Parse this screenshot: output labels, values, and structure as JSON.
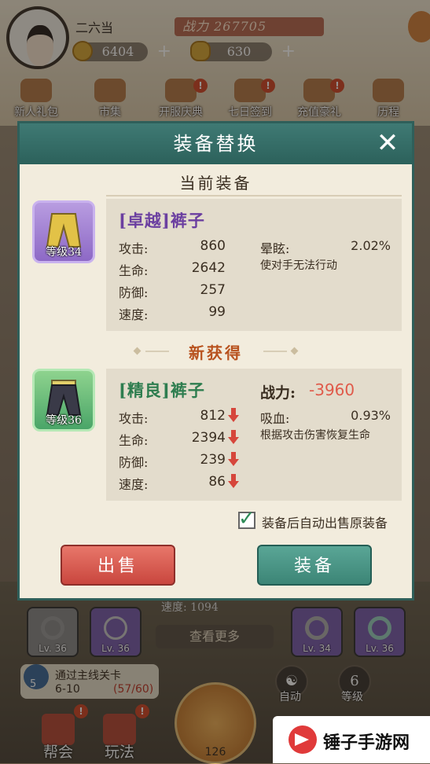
{
  "player": {
    "name": "二六当",
    "power_label": "战力 267705",
    "coins": "6404",
    "ingots": "630"
  },
  "top_menu": [
    {
      "label": "新人礼包",
      "badge": ""
    },
    {
      "label": "市集",
      "badge": ""
    },
    {
      "label": "开服庆典",
      "badge": "!"
    },
    {
      "label": "七日签到",
      "badge": "!"
    },
    {
      "label": "充值豪礼",
      "badge": "!"
    },
    {
      "label": "历程",
      "badge": ""
    }
  ],
  "modal": {
    "title": "装备替换",
    "close_symbol": "✕",
    "current_section": "当前装备",
    "new_section": "新获得",
    "current": {
      "name": "[卓越]裤子",
      "name_color": "#6b3fa0",
      "level": "等级34",
      "stats": [
        {
          "label": "攻击:",
          "value": "860"
        },
        {
          "label": "生命:",
          "value": "2642"
        },
        {
          "label": "防御:",
          "value": "257"
        },
        {
          "label": "速度:",
          "value": "99"
        }
      ],
      "skill_name": "晕眩:",
      "skill_value": "2.02%",
      "skill_desc": "使对手无法行动"
    },
    "new": {
      "name": "[精良]裤子",
      "name_color": "#2e7d4f",
      "level": "等级36",
      "power_label": "战力:",
      "power_delta": "-3960",
      "stats": [
        {
          "label": "攻击:",
          "value": "812"
        },
        {
          "label": "生命:",
          "value": "2394"
        },
        {
          "label": "防御:",
          "value": "239"
        },
        {
          "label": "速度:",
          "value": "86"
        }
      ],
      "skill_name": "吸血:",
      "skill_value": "0.93%",
      "skill_desc": "根据攻击伤害恢复生命"
    },
    "auto_sell_label": "装备后自动出售原装备",
    "auto_sell_checked": true,
    "sell_button": "出售",
    "equip_button": "装备"
  },
  "bottom": {
    "speed_text": "速度:        1094",
    "more_button": "查看更多",
    "slots_left": [
      "Lv. 36",
      "Lv. 36"
    ],
    "slots_right": [
      "Lv. 34",
      "Lv. 36"
    ],
    "quest_title": "通过主线关卡",
    "quest_stage": "6-10",
    "quest_progress": "(57/60)",
    "quest_number": "5",
    "auto_label": "自动",
    "level_label": "等级",
    "level_value": "6",
    "main_count": "126",
    "nav": [
      {
        "label": "帮会"
      },
      {
        "label": "玩法"
      }
    ],
    "watermark": "锤子手游网"
  },
  "colors": {
    "header": "#2f5f5a",
    "sell": "#d4554b",
    "equip": "#4a9686",
    "delta": "#e05a4a"
  }
}
